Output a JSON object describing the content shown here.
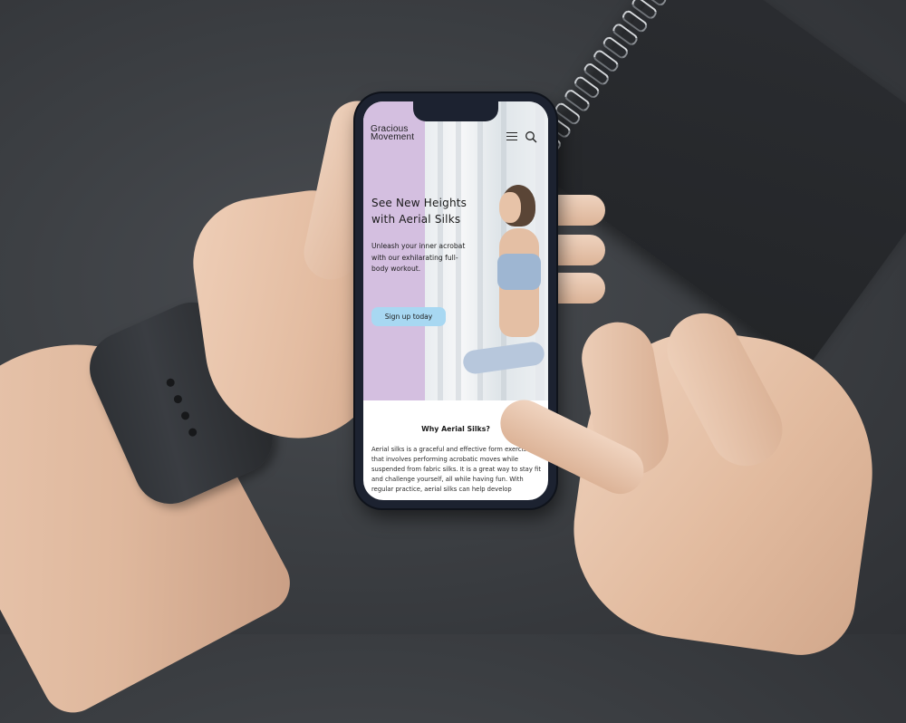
{
  "site": {
    "logo_line1": "Gracious",
    "logo_line2": "Movement"
  },
  "header": {
    "menu_icon": "hamburger-menu-icon",
    "search_icon": "search-icon"
  },
  "hero": {
    "title": "See New Heights with Aerial Silks",
    "subtitle": "Unleash your inner acrobat with our exhilarating full-body workout.",
    "cta_label": "Sign up today"
  },
  "section": {
    "title": "Why Aerial Silks?",
    "body": "Aerial silks is a graceful and effective form exercise that involves performing acrobatic moves while suspended from fabric silks. It is a great way to stay fit and challenge yourself, all while having fun. With regular practice, aerial silks can help develop"
  },
  "colors": {
    "accent_lilac": "#d4bfe0",
    "cta_blue": "#a8d8f2",
    "phone_frame": "#1c2230",
    "desk": "#3d4044"
  }
}
